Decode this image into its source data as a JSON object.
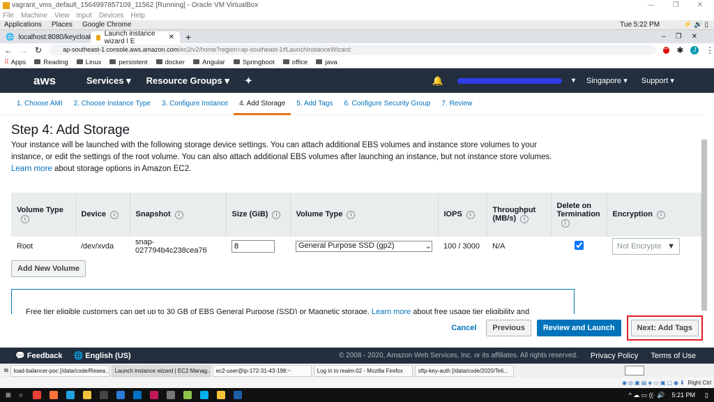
{
  "vm_window": {
    "title": "vagrant_vms_default_1564997857109_11562 [Running] - Oracle VM VirtualBox",
    "menu": [
      "File",
      "Machine",
      "View",
      "Input",
      "Devices",
      "Help"
    ]
  },
  "gnome_bar": {
    "items": [
      "Applications",
      "Places",
      "Google Chrome"
    ],
    "clock": "Tue  5:22 PM"
  },
  "browser": {
    "tabs": [
      {
        "label": "localhost:8080/keycloak/r"
      },
      {
        "label": "Launch instance wizard | E"
      }
    ],
    "new_tab": "+",
    "url_host": "ap-southeast-1.console.aws.amazon.com",
    "url_path": "/ec2/v2/home?region=ap-southeast-1#LaunchInstanceWizard:",
    "profile_initial": "J",
    "adblock_label": "ABP",
    "bookmarks": [
      "Apps",
      "Reading",
      "Linux",
      "persistent",
      "docker",
      "Angular",
      "Springboot",
      "office",
      "java"
    ]
  },
  "aws_nav": {
    "logo": "aws",
    "services": "Services",
    "resource_groups": "Resource Groups",
    "region": "Singapore",
    "support": "Support"
  },
  "wizard": {
    "steps": [
      "1. Choose AMI",
      "2. Choose Instance Type",
      "3. Configure Instance",
      "4. Add Storage",
      "5. Add Tags",
      "6. Configure Security Group",
      "7. Review"
    ],
    "current_step": 3,
    "title": "Step 4: Add Storage",
    "desc_1": "Your instance will be launched with the following storage device settings. You can attach additional EBS volumes and instance store volumes to your instance, or edit the settings of the root volume. You can also attach additional EBS volumes after launching an instance, but not instance store volumes.",
    "learn_more": "Learn more",
    "desc_2": "about storage options in Amazon EC2.",
    "columns": [
      "Volume Type",
      "Device",
      "Snapshot",
      "Size (GiB)",
      "Volume Type",
      "IOPS",
      "Throughput (MB/s)",
      "Delete on Termination",
      "Encryption"
    ],
    "row": {
      "volume_type": "Root",
      "device": "/dev/xvda",
      "snapshot_1": "snap-",
      "snapshot_2": "027794b4c238cea76",
      "size": "8",
      "ebs_type": "General Purpose SSD (gp2)",
      "iops": "100 / 3000",
      "throughput": "N/A",
      "delete_on_termination": true,
      "encryption": "Not Encrypte"
    },
    "add_volume": "Add New Volume",
    "free_tier_1": "Free tier eligible customers can get up to 30 GB of EBS General Purpose (SSD) or Magnetic storage.",
    "free_tier_link": "Learn more",
    "free_tier_2": "about free usage tier eligibility and",
    "cancel": "Cancel",
    "previous": "Previous",
    "review_launch": "Review and Launch",
    "next": "Next: Add Tags"
  },
  "footer": {
    "feedback": "Feedback",
    "language": "English (US)",
    "copyright": "© 2008 - 2020, Amazon Web Services, Inc. or its affiliates. All rights reserved.",
    "privacy": "Privacy Policy",
    "terms": "Terms of Use"
  },
  "vm_taskbar": [
    "load-balancer-poc [/data/code/Resea...",
    "Launch instance wizard | EC2 Manag...",
    "ec2-user@ip-172-31-43-198:~",
    "Log in to realm-02 - Mozilla Firefox",
    "sftp-key-auth [/data/code/2020/Teli..."
  ],
  "vm_status": {
    "host_key": "Right Ctrl"
  },
  "windows_taskbar": {
    "clock": "5:21 PM"
  },
  "colors": {
    "aws_nav": "#232f3e",
    "primary": "#ec7211",
    "review_button": "#0073bb",
    "link": "#0073bb",
    "highlight_box": "#e02020"
  }
}
